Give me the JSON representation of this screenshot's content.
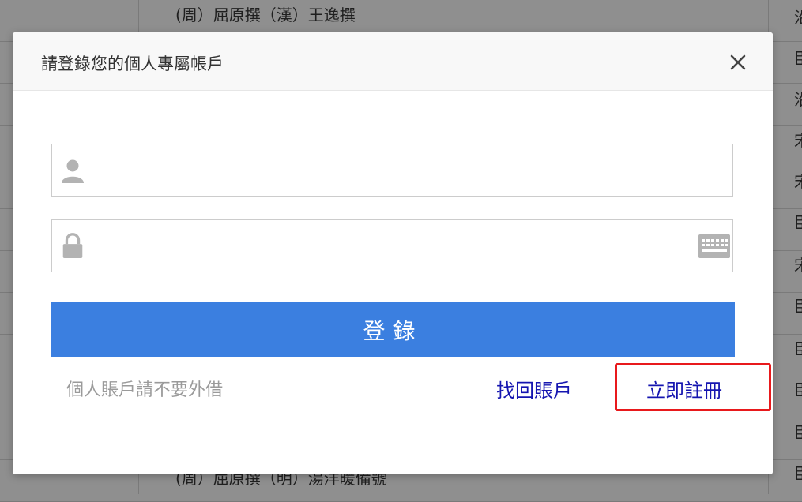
{
  "background": {
    "top_row_text": "(周）屈原撰（漢）王逸撰",
    "bottom_row_text": "(周）屈原撰（明）湯洋暖備號",
    "side_chars": [
      "沿",
      "臣",
      "沿",
      "宋",
      "宋",
      "臣",
      "宋",
      "臣",
      "臣",
      "臣",
      "臣",
      "臣"
    ]
  },
  "modal": {
    "title": "請登錄您的個人專屬帳戶",
    "close_glyph": "×",
    "username": {
      "value": "",
      "placeholder": ""
    },
    "password": {
      "value": "",
      "placeholder": ""
    },
    "login_label": "登錄",
    "notice": "個人賬戶請不要外借",
    "recover_link": "找回賬戶",
    "register_link": "立即註冊"
  },
  "icons": {
    "user": "user-icon",
    "lock": "lock-icon",
    "keyboard": "keyboard-icon",
    "close": "close-icon"
  },
  "colors": {
    "primary": "#3b7fe0",
    "link": "#1515b0",
    "highlight": "#e8191c",
    "overlay": "#8f8f8f"
  }
}
